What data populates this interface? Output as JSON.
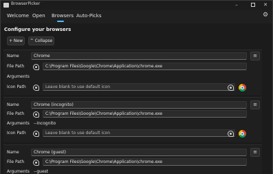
{
  "window": {
    "title": "BrowserPicker"
  },
  "nav": {
    "tabs": [
      "Welcome",
      "Open",
      "Browsers",
      "Auto-Picks"
    ]
  },
  "content": {
    "heading": "Configure your browsers",
    "new_label": "+ New",
    "collapse_label": "^ Collapse"
  },
  "labels": {
    "name": "Name",
    "file_path": "File Path",
    "arguments": "Arguments",
    "icon_path": "Icon Path"
  },
  "icon_placeholder": "Leave blank to use default icon",
  "menu_glyph": "≡",
  "browsers": [
    {
      "name": "Chrome",
      "file_path": "C:\\Program Files\\Google\\Chrome\\Application\\chrome.exe",
      "arguments": ""
    },
    {
      "name": "Chrome (incognito)",
      "file_path": "C:\\Program Files\\Google\\Chrome\\Application\\chrome.exe",
      "arguments": "--incognito"
    },
    {
      "name": "Chrome (guest)",
      "file_path": "C:\\Program Files\\Google\\Chrome\\Application\\chrome.exe",
      "arguments": "--guest"
    }
  ]
}
